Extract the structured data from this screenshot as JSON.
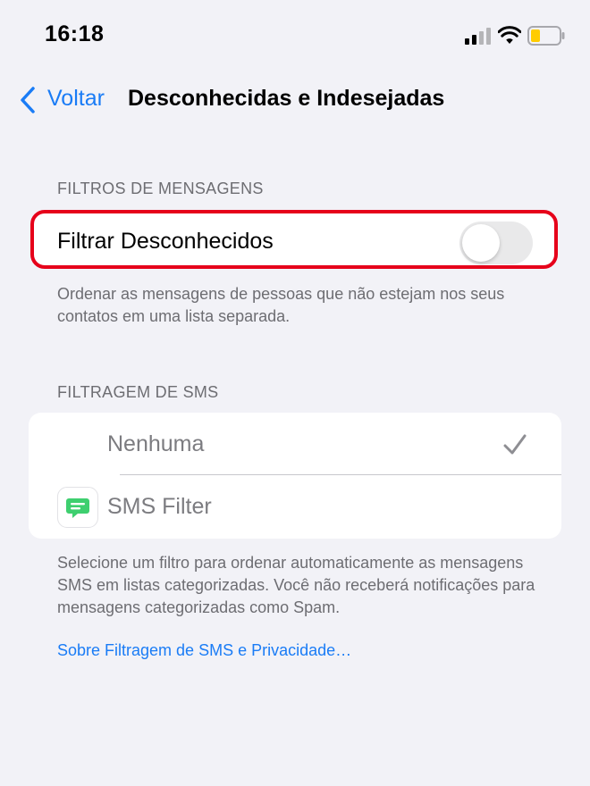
{
  "status_bar": {
    "time": "16:18",
    "icons": [
      "cellular-signal-icon",
      "wifi-icon",
      "battery-icon"
    ],
    "battery_color": "#ffcc00"
  },
  "nav": {
    "back_label": "Voltar",
    "title": "Desconhecidas e Indesejadas"
  },
  "filtros": {
    "header": "FILTROS DE MENSAGENS",
    "toggle_label": "Filtrar Desconhecidos",
    "toggle_on": false,
    "footer": "Ordenar as mensagens de pessoas que não estejam nos seus contatos em uma lista separada."
  },
  "sms": {
    "header": "FILTRAGEM DE SMS",
    "options": [
      {
        "label": "Nenhuma",
        "selected": true
      },
      {
        "label": "SMS Filter",
        "selected": false,
        "icon": "message-bubble-icon"
      }
    ],
    "footer": "Selecione um filtro para ordenar automaticamente as mensagens SMS em listas categorizadas. Você não receberá notificações para mensagens categorizadas como Spam.",
    "link": "Sobre Filtragem de SMS e Privacidade…"
  },
  "colors": {
    "accent": "#1a7cf6",
    "highlight": "#e6001a",
    "sms_icon": "#3ecf6f"
  }
}
